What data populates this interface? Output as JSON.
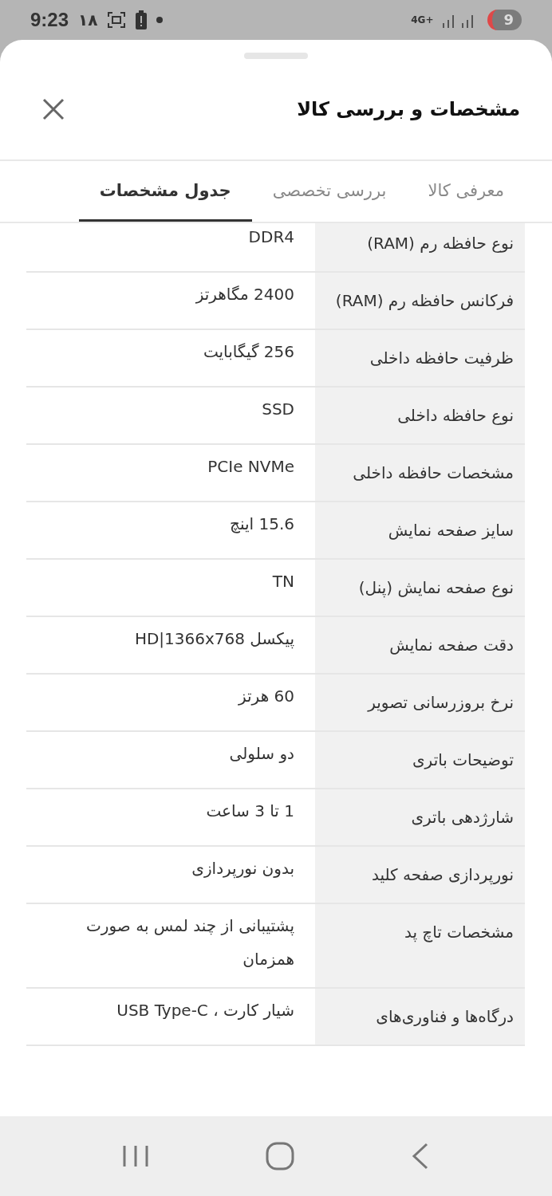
{
  "status_bar": {
    "time": "9:23",
    "notification": "١٨",
    "network": "4G+",
    "battery": "9"
  },
  "sheet": {
    "title": "مشخصات و بررسی کالا"
  },
  "tabs": [
    {
      "label": "معرفی کالا",
      "selected": false
    },
    {
      "label": "بررسی تخصصی",
      "selected": false
    },
    {
      "label": "جدول مشخصات",
      "selected": true
    }
  ],
  "specs": [
    {
      "label": "نوع حافظه رم (RAM)",
      "value": "DDR4"
    },
    {
      "label": "فرکانس حافظه رم (RAM)",
      "value": "2400 مگاهرتز"
    },
    {
      "label": "ظرفیت حافظه داخلی",
      "value": "256 گیگابایت"
    },
    {
      "label": "نوع حافظه داخلی",
      "value": "SSD"
    },
    {
      "label": "مشخصات حافظه داخلی",
      "value": "PCIe NVMe"
    },
    {
      "label": "سایز صفحه نمایش",
      "value": "15.6 اینچ"
    },
    {
      "label": "نوع صفحه نمایش (پنل)",
      "value": "TN"
    },
    {
      "label": "دقت صفحه نمایش",
      "value": "پیکسل HD|1366x768"
    },
    {
      "label": "نرخ بروزرسانی تصویر",
      "value": "60 هرتز"
    },
    {
      "label": "توضیحات باتری",
      "value": "دو سلولی"
    },
    {
      "label": "شارژدهی باتری",
      "value": "1 تا 3 ساعت"
    },
    {
      "label": "نورپردازی صفحه کلید",
      "value": "بدون نورپردازی"
    },
    {
      "label": "مشخصات تاچ پد",
      "value": "پشتیبانی از چند لمس به صورت همزمان"
    },
    {
      "label": "درگاه‌ها و فناوری‌های",
      "value": "شیار کارت ، USB Type-C"
    }
  ]
}
